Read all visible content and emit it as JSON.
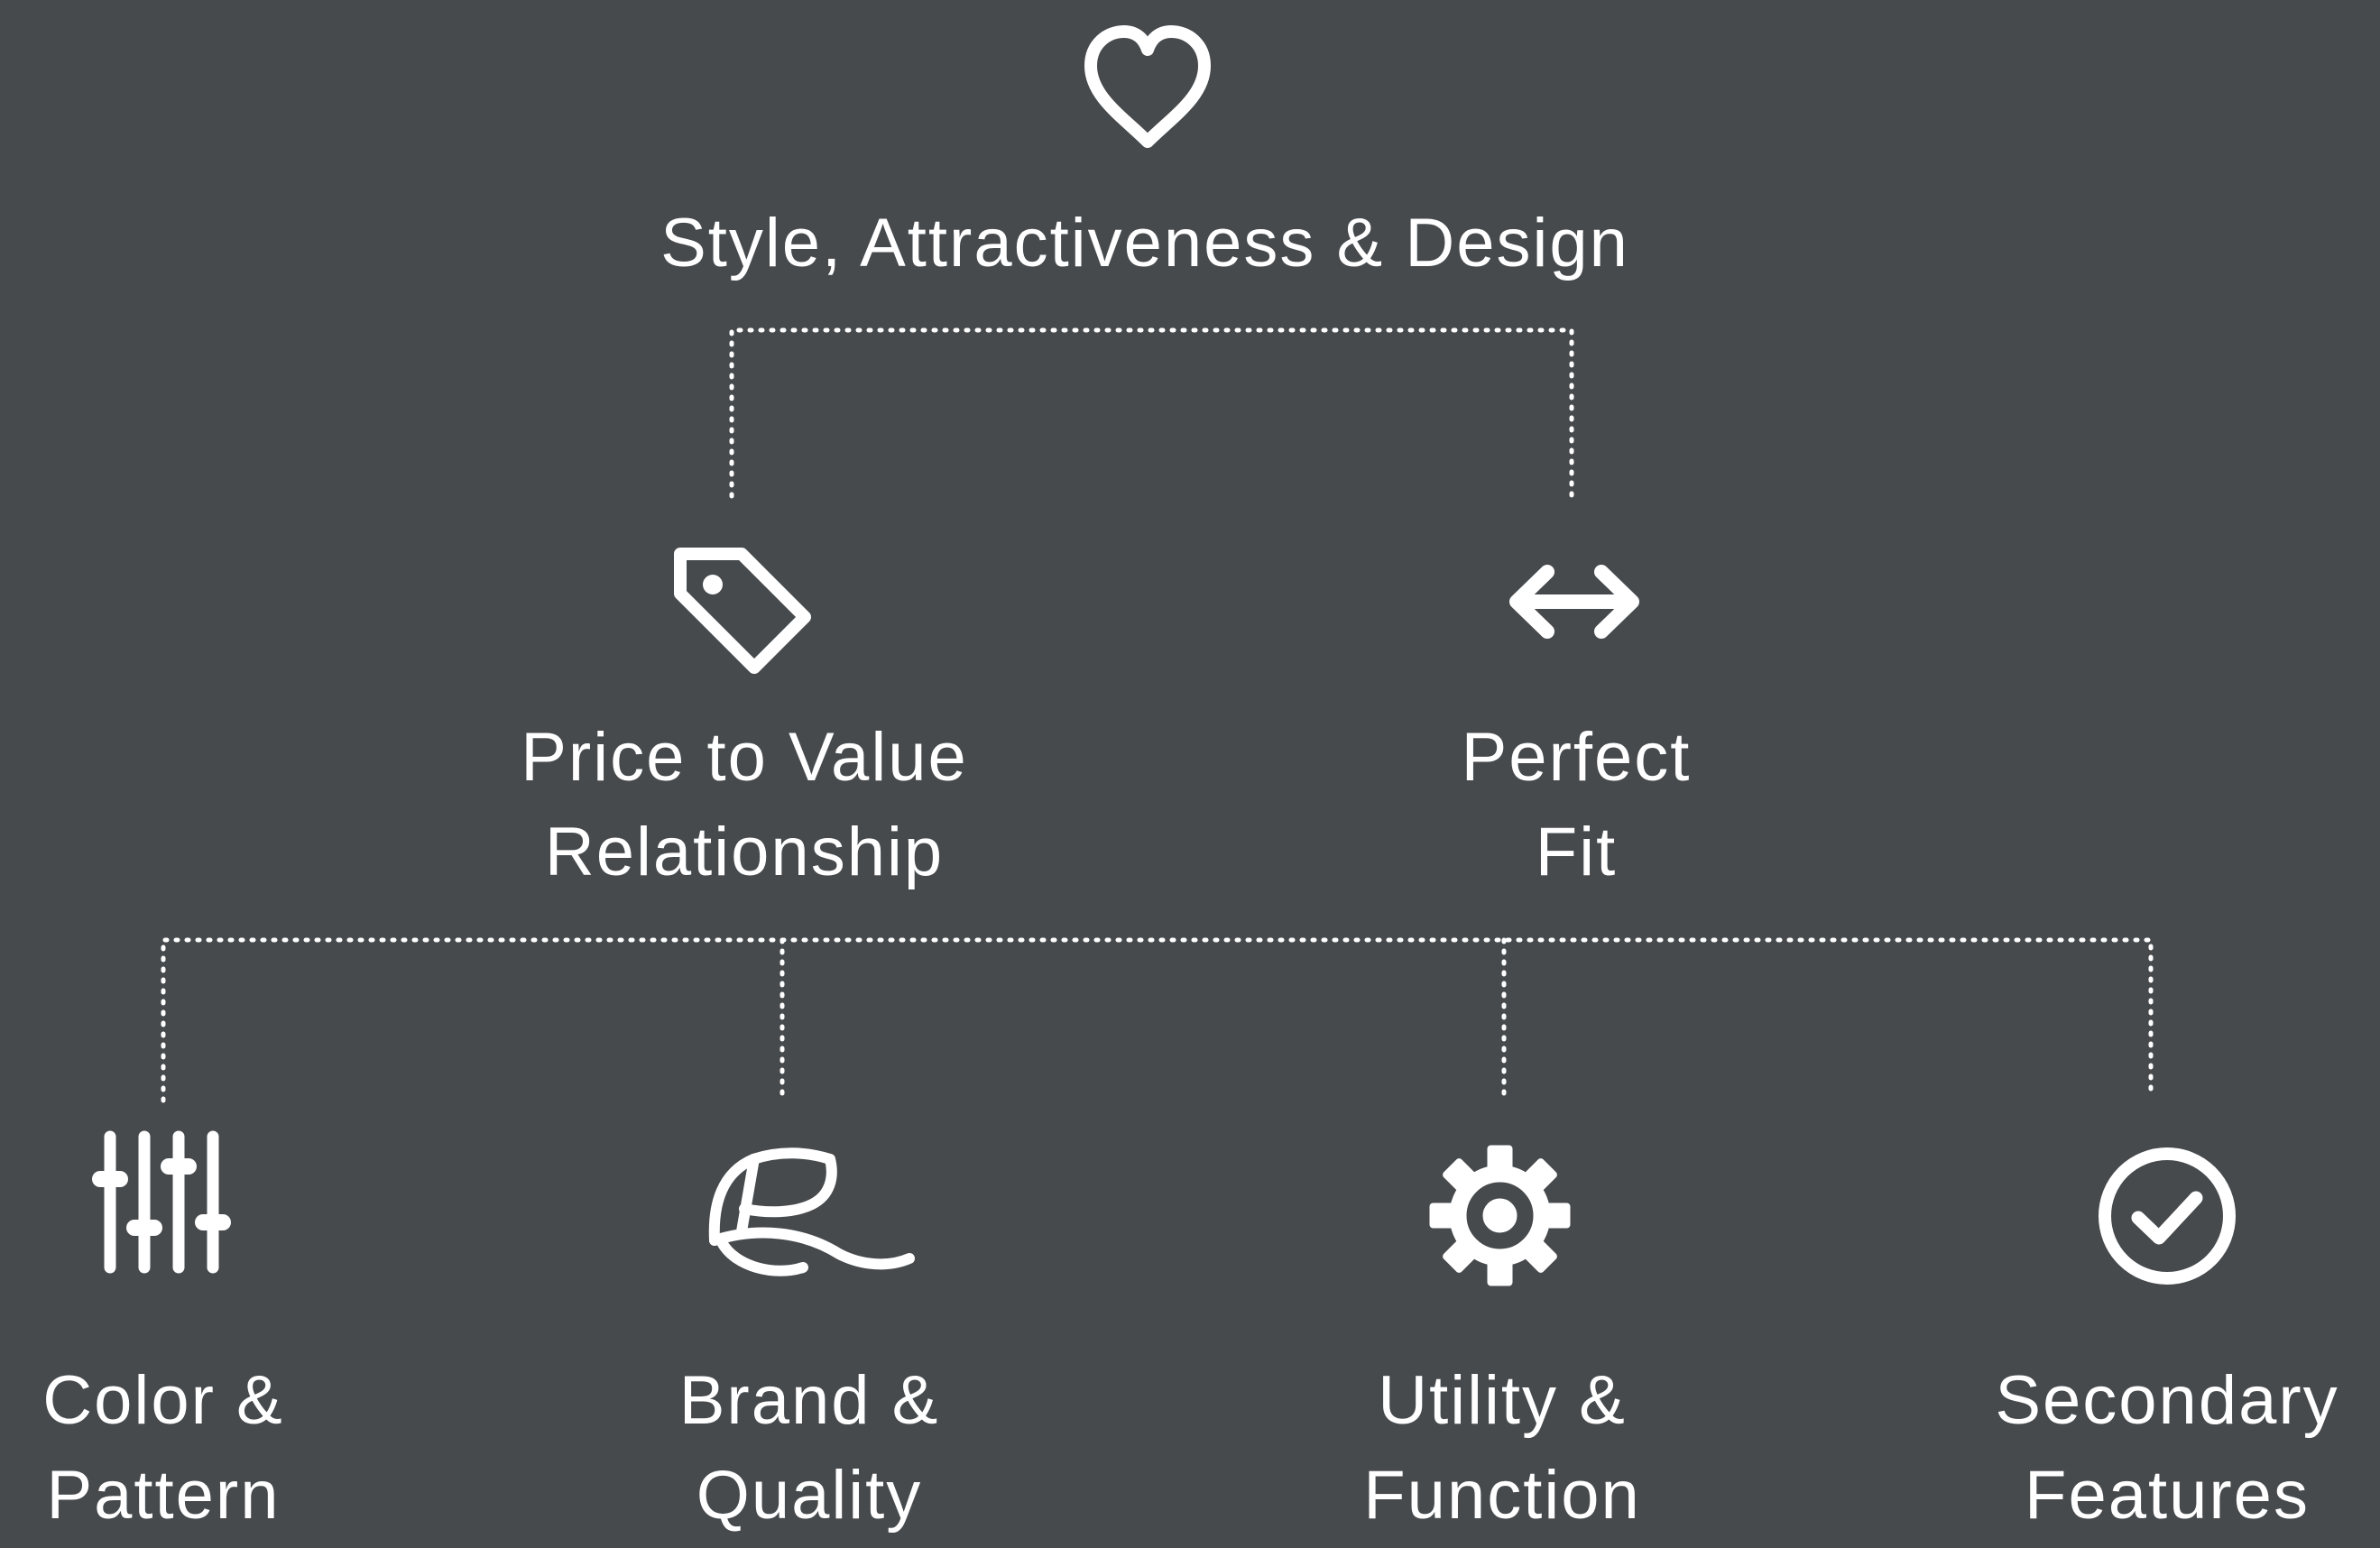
{
  "colors": {
    "background": "#464a4d",
    "foreground": "#ffffff"
  },
  "root": {
    "label": "Style, Attractiveness & Design",
    "icon": "heart-icon"
  },
  "level2": [
    {
      "line1": "Price to Value",
      "line2": "Relationship",
      "icon": "price-tag-icon"
    },
    {
      "line1": "Perfect",
      "line2": "Fit",
      "icon": "double-arrow-icon"
    }
  ],
  "level3": [
    {
      "line1": "Color &",
      "line2": "Pattern",
      "icon": "sliders-icon"
    },
    {
      "line1": "Brand &",
      "line2": "Quality",
      "icon": "cap-icon"
    },
    {
      "line1": "Utility &",
      "line2": "Function",
      "icon": "gear-icon"
    },
    {
      "line1": "Secondary",
      "line2": "Features",
      "icon": "check-circle-icon"
    }
  ]
}
